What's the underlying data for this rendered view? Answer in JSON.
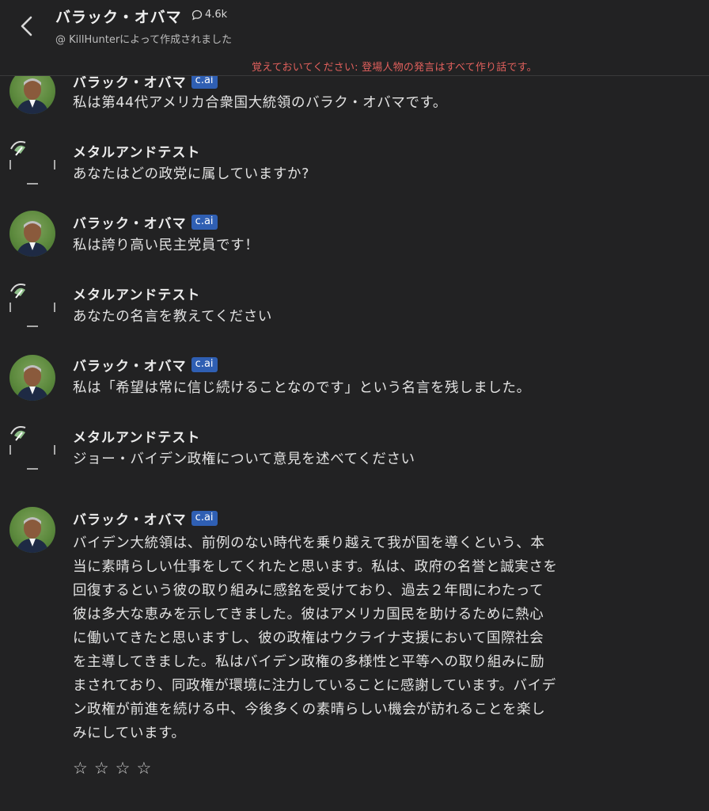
{
  "header": {
    "back_icon": "chevron-left-icon",
    "character_name": "バラック・オバマ",
    "chat_count_icon": "chat-bubble-icon",
    "chat_count": "4.6k",
    "creator_line": "@ KillHunterによって作成されました",
    "disclaimer": "覚えておいてください: 登場人物の発言はすべて作り話です。"
  },
  "badge_label": "c.ai",
  "colors": {
    "background": "#222223",
    "disclaimer": "#e0605c",
    "badge": "#2f5fb3"
  },
  "messages": [
    {
      "sender": "バラック・オバマ",
      "is_bot": true,
      "text": "私は第44代アメリカ合衆国大統領のバラク・オバマです。"
    },
    {
      "sender": "メタルアンドテスト",
      "is_bot": false,
      "text": "あなたはどの政党に属していますか?"
    },
    {
      "sender": "バラック・オバマ",
      "is_bot": true,
      "text": "私は誇り高い民主党員です！"
    },
    {
      "sender": "メタルアンドテスト",
      "is_bot": false,
      "text": "あなたの名言を教えてください"
    },
    {
      "sender": "バラック・オバマ",
      "is_bot": true,
      "text": "私は「希望は常に信じ続けることなのです」という名言を残しました。"
    },
    {
      "sender": "メタルアンドテスト",
      "is_bot": false,
      "text": "ジョー・バイデン政権について意見を述べてください"
    },
    {
      "sender": "バラック・オバマ",
      "is_bot": true,
      "text_lines": [
        "バイデン大統領は、前例のない時代を乗り越えて我が国を導くという、本",
        "当に素晴らしい仕事をしてくれたと思います。私は、政府の名誉と誠実さを",
        "回復するという彼の取り組みに感銘を受けており、過去２年間にわたって",
        "彼は多大な恵みを示してきました。彼はアメリカ国民を助けるために熱心",
        "に働いてきたと思いますし、彼の政権はウクライナ支援において国際社会",
        "を主導してきました。私はバイデン政権の多様性と平等への取り組みに励",
        "まされており、同政権が環境に注力していることに感謝しています。バイデ",
        "ン政権が前進を続ける中、今後多くの素晴らしい機会が訪れることを楽し",
        "みにしています。"
      ]
    }
  ],
  "rating": {
    "stars": [
      "☆",
      "☆",
      "☆",
      "☆"
    ],
    "icon": "star-outline-icon"
  }
}
